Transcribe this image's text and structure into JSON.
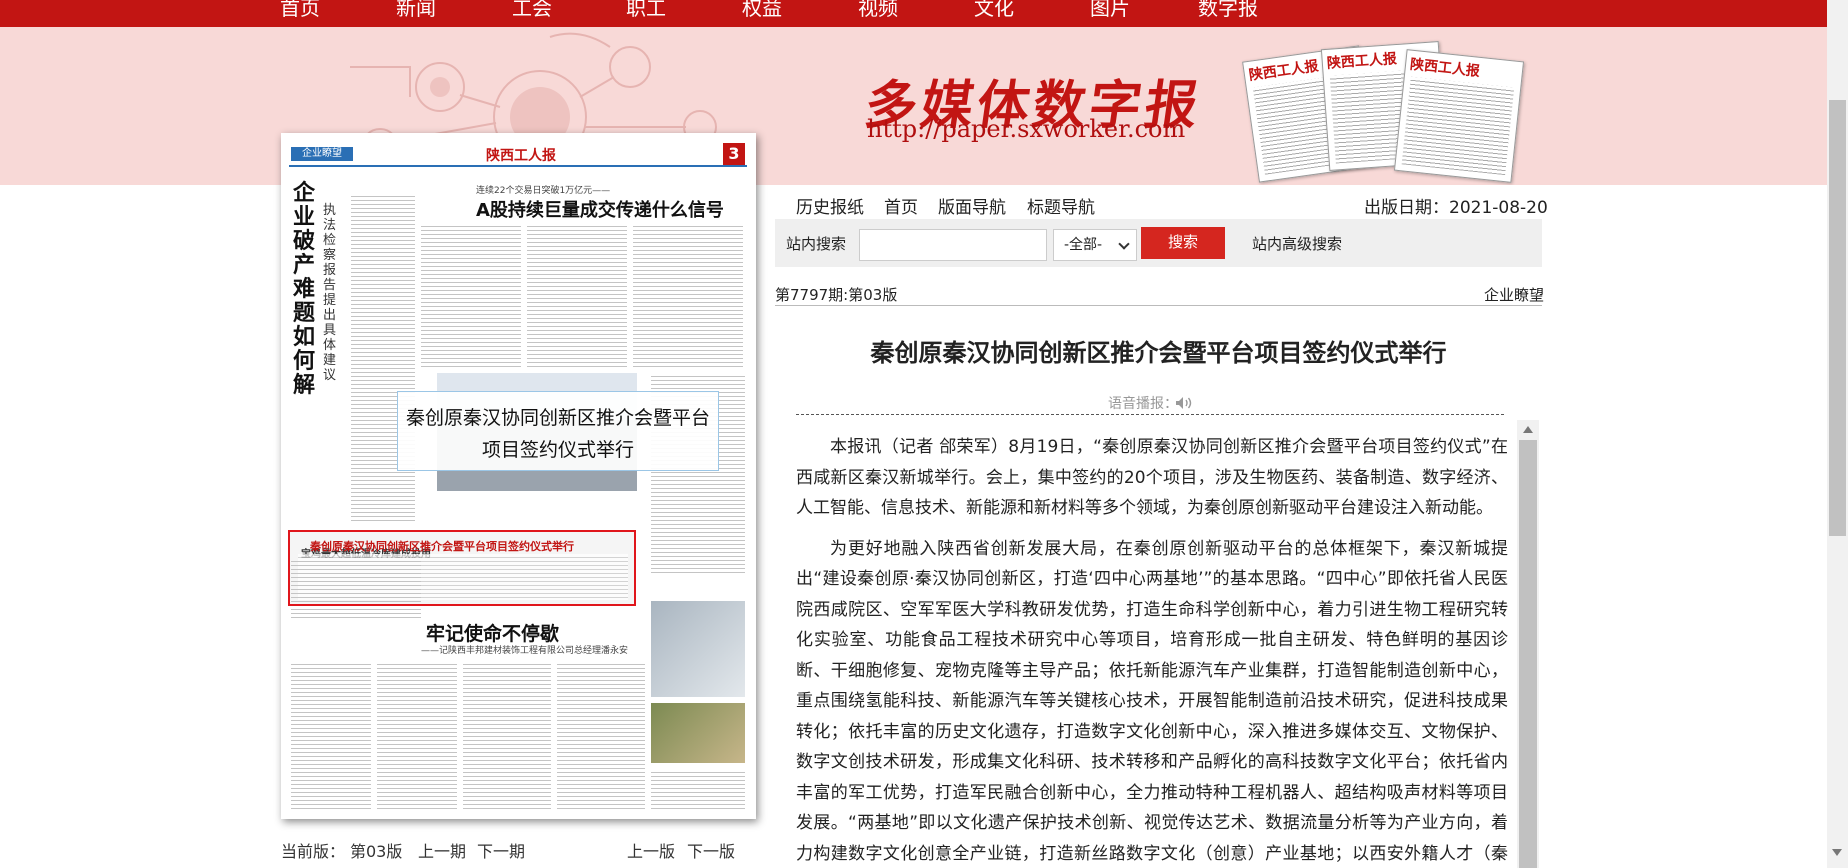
{
  "nav": {
    "items": [
      "首页",
      "新闻",
      "工会",
      "职工",
      "权益",
      "视频",
      "文化",
      "图片",
      "数字报"
    ]
  },
  "banner": {
    "title": "多媒体数字报",
    "url": "http://paper.sxworker.com",
    "paper_masthead": "陕西工人报"
  },
  "page_image": {
    "section_label": "企业瞭望",
    "masthead": "陕西工人报",
    "page_number": "3",
    "vertical_title": "企业破产难题如何解",
    "vertical_subtitle": "执法检察报告提出具体建议",
    "headline_top_kicker": "连续22个交易日突破1万亿元——",
    "headline_top": "A股持续巨量成交传递什么信号",
    "headline_left_mid": "宝鸡最大超低温冷库建成投用",
    "overlay_title": "秦创原秦汉协同创新区推介会暨平台项目签约仪式举行",
    "hotbox_title": "秦创原秦汉协同创新区推介会暨平台项目签约仪式举行",
    "headline_bottom": "牢记使命不停歇",
    "headline_bottom_sub": "——记陕西丰邦建材装饰工程有限公司总经理潘永安"
  },
  "page_nav": {
    "current_label": "当前版：",
    "current_page": "第03版",
    "prev_issue": "上一期",
    "next_issue": "下一期",
    "prev_page": "上一版",
    "next_page": "下一版"
  },
  "toolbar": {
    "history": "历史报纸",
    "home": "首页",
    "page_nav": "版面导航",
    "title_nav": "标题导航",
    "pub_date_label": "出版日期：",
    "pub_date": "2021-08-20"
  },
  "search": {
    "label": "站内搜索",
    "value": "",
    "scope": "-全部-",
    "button": "搜索",
    "advanced": "站内高级搜索"
  },
  "article": {
    "issue": "第7797期:第03版",
    "section": "企业瞭望",
    "title": "秦创原秦汉协同创新区推介会暨平台项目签约仪式举行",
    "voice_label": "语音播报：",
    "paragraphs": [
      "本报讯（记者 郃荣军）8月19日，“秦创原秦汉协同创新区推介会暨平台项目签约仪式”在西咸新区秦汉新城举行。会上，集中签约的20个项目，涉及生物医药、装备制造、数字经济、人工智能、信息技术、新能源和新材料等多个领域，为秦创原创新驱动平台建设注入新动能。",
      "为更好地融入陕西省创新发展大局，在秦创原创新驱动平台的总体框架下，秦汉新城提出“建设秦创原·秦汉协同创新区，打造‘四中心两基地’”的基本思路。“四中心”即依托省人民医院西咸院区、空军军医大学科教研发优势，打造生命科学创新中心，着力引进生物工程研究转化实验室、功能食品工程技术研究中心等项目，培育形成一批自主研发、特色鲜明的基因诊断、干细胞修复、宠物克隆等主导产品；依托新能源汽车产业集群，打造智能制造创新中心，重点围绕氢能科技、新能源汽车等关键核心技术，开展智能制造前沿技术研究，促进科技成果转化；依托丰富的历史文化遗存，打造数字文化创新中心，深入推进多媒体交互、文物保护、数字文创技术研发，形成集文化科研、技术转移和产品孵化的高科技数字文化平台；依托省内丰富的军工优势，打造军民融合创新中心，全力推动特种工程机器人、超结构吸声材料等项目发展。“两基地”即以文化遗产保护技术创新、视觉传达艺术、数据流量分析等为产业方向，着力构建数字文化创意全产业链，打造新丝路数字文化（创意）产业基地；以西安外籍人才（秦汉新城）服务中"
    ]
  },
  "colors": {
    "brand_red": "#c21513",
    "banner_pink": "#f8d9d7",
    "search_button": "#d5261f"
  }
}
